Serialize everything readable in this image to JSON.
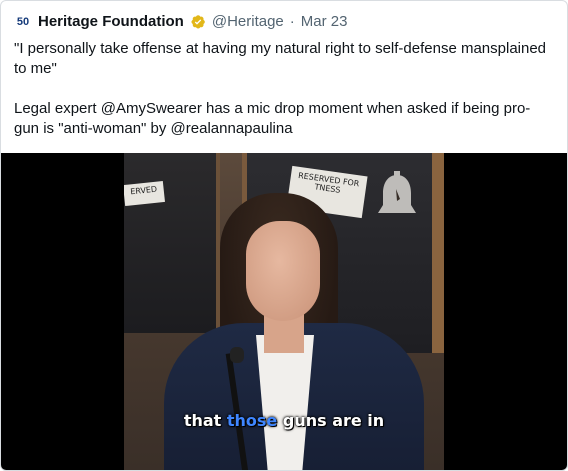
{
  "tweet": {
    "avatar_text": "50",
    "display_name": "Heritage Foundation",
    "handle": "@Heritage",
    "separator": "·",
    "date": "Mar 23",
    "text_line1": "\"I personally take offense at having my natural right to self-defense mansplained to me\"",
    "text_line2": "Legal expert @AmySwearer has a mic drop moment when asked if being pro-gun is \"anti-woman\" by @realannapaulina"
  },
  "media": {
    "sign_left": "ERVED",
    "sign_center": "RESERVED FOR TNESS",
    "caption_pre": "that",
    "caption_highlight": "those",
    "caption_post": "guns are in"
  },
  "colors": {
    "verified": "#e2b719",
    "caption_highlight": "#3f86ff",
    "muted_text": "#536471"
  }
}
